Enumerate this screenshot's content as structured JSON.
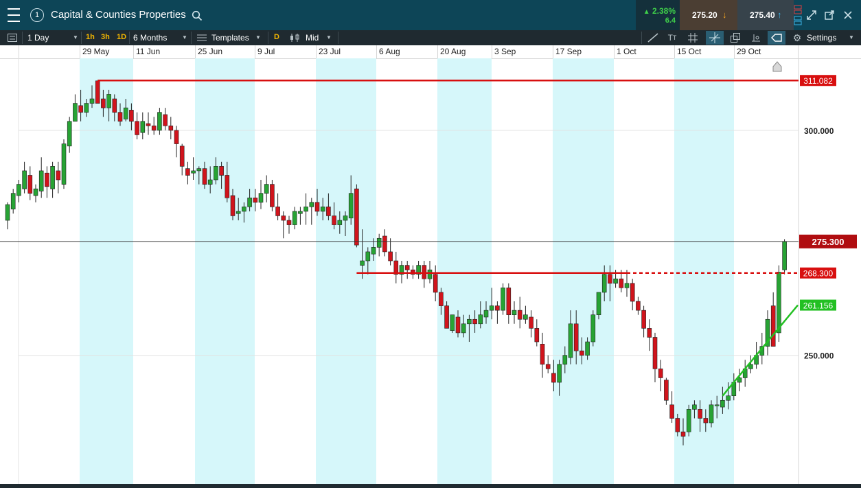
{
  "header": {
    "title": "Capital & Counties Properties",
    "tab_number": "1",
    "change_percent": "2.38%",
    "change_abs": "6.4",
    "sell_price": "275.20",
    "buy_price": "275.40"
  },
  "toolbar": {
    "interval": "1 Day",
    "quick_1": "1h",
    "quick_2": "3h",
    "quick_3": "1D",
    "range": "6 Months",
    "templates": "Templates",
    "d_label": "D",
    "price_type": "Mid",
    "settings": "Settings"
  },
  "colors": {
    "up": "#27a334",
    "down": "#d0141c",
    "resistance": "#d80f0f",
    "support": "#23c023",
    "band": "#d6f7fa",
    "header": "#0d4557",
    "toolbar": "#1f2a30"
  },
  "icons": [
    "menu-icon",
    "search-icon",
    "draw-line-icon",
    "text-icon",
    "grid-icon",
    "crosshair-icon",
    "layers-icon",
    "indicator-icon",
    "tag-icon",
    "gear-icon",
    "expand-icon",
    "popout-icon",
    "close-icon"
  ],
  "chart_data": {
    "type": "candlestick",
    "x_axis_labels": [
      "29 May",
      "11 Jun",
      "25 Jun",
      "9 Jul",
      "23 Jul",
      "6 Aug",
      "20 Aug",
      "3 Sep",
      "17 Sep",
      "1 Oct",
      "15 Oct",
      "29 Oct"
    ],
    "y_ticks": [
      250,
      300
    ],
    "y_tick_labels": [
      "250.000",
      "300.000"
    ],
    "ylim": [
      226,
      316
    ],
    "current_price": 275.3,
    "current_price_label": "275.300",
    "levels": [
      {
        "value": 311.082,
        "label": "311.082",
        "start_index": 16,
        "style": "solid",
        "color": "#d80f0f"
      },
      {
        "value": 268.3,
        "label": "268.300",
        "start_index": 62,
        "style": "solid-then-dashed",
        "dash_from_index": 110,
        "color": "#d80f0f"
      }
    ],
    "trendline": {
      "from_index": 127,
      "from_value": 241,
      "to_index": 146,
      "to_value": 261.156,
      "label": "261.156",
      "color": "#23c023"
    },
    "candles": [
      [
        280,
        284,
        278,
        283.5
      ],
      [
        282.5,
        287,
        281.5,
        286
      ],
      [
        285.5,
        289,
        284,
        288
      ],
      [
        287,
        293,
        286,
        291
      ],
      [
        290,
        292,
        284.5,
        286
      ],
      [
        285.5,
        288,
        284,
        287
      ],
      [
        286.5,
        294,
        285,
        291
      ],
      [
        290.5,
        292,
        285,
        287.5
      ],
      [
        287,
        293,
        285,
        292
      ],
      [
        291,
        293,
        286,
        289
      ],
      [
        288,
        298,
        287,
        297
      ],
      [
        296.5,
        303,
        295,
        302
      ],
      [
        302,
        308,
        302,
        306
      ],
      [
        305.5,
        309,
        302,
        304
      ],
      [
        304,
        307,
        303,
        306
      ],
      [
        306,
        310,
        305,
        307
      ],
      [
        311,
        311,
        307,
        306
      ],
      [
        307,
        309,
        303,
        305
      ],
      [
        305,
        309,
        302,
        308
      ],
      [
        307,
        308,
        302,
        304
      ],
      [
        304,
        306,
        301,
        302
      ],
      [
        302.5,
        307,
        302,
        305
      ],
      [
        304.5,
        306,
        300,
        302
      ],
      [
        302,
        304,
        298,
        299
      ],
      [
        299.5,
        304,
        298,
        302
      ],
      [
        301.5,
        304,
        299,
        301
      ],
      [
        301,
        303,
        299,
        300
      ],
      [
        300,
        305,
        299,
        304
      ],
      [
        303.5,
        305,
        300,
        301
      ],
      [
        301,
        303,
        298,
        300
      ],
      [
        300,
        301,
        294,
        297
      ],
      [
        296.5,
        297,
        290,
        292
      ],
      [
        291.5,
        293,
        288,
        290
      ],
      [
        290.5,
        294,
        289,
        291
      ],
      [
        291,
        292,
        288,
        291.5
      ],
      [
        291.5,
        293,
        287,
        288
      ],
      [
        288,
        292,
        286,
        289
      ],
      [
        289,
        294,
        288,
        292
      ],
      [
        292,
        293,
        287,
        290
      ],
      [
        290,
        293,
        284,
        285
      ],
      [
        285.5,
        287,
        280,
        281
      ],
      [
        281.5,
        285,
        280,
        282
      ],
      [
        282,
        284,
        279.5,
        283
      ],
      [
        283,
        287,
        282,
        285
      ],
      [
        285,
        287,
        282,
        284
      ],
      [
        284,
        289,
        282.5,
        286
      ],
      [
        286,
        290,
        284,
        288
      ],
      [
        288,
        289,
        282,
        283
      ],
      [
        283,
        286,
        280,
        281
      ],
      [
        281,
        282,
        276,
        280
      ],
      [
        280,
        281,
        277,
        279
      ],
      [
        279,
        283,
        278,
        282
      ],
      [
        281.5,
        283,
        279,
        282
      ],
      [
        282,
        286,
        279,
        283
      ],
      [
        283,
        285,
        279,
        284
      ],
      [
        284,
        287,
        281,
        282
      ],
      [
        282,
        285,
        280,
        283
      ],
      [
        283,
        286,
        280,
        281
      ],
      [
        281,
        284,
        278,
        279
      ],
      [
        279,
        282,
        277,
        280
      ],
      [
        280,
        282,
        276.5,
        281
      ],
      [
        280.5,
        290,
        279,
        286
      ],
      [
        287,
        288,
        274,
        274.5
      ],
      [
        270,
        278,
        267,
        271
      ],
      [
        271,
        274,
        268,
        273
      ],
      [
        272.5,
        276,
        271,
        274
      ],
      [
        274,
        277,
        272,
        276
      ],
      [
        276.5,
        278,
        272,
        273
      ],
      [
        273,
        276,
        270,
        271
      ],
      [
        271,
        273,
        266,
        268
      ],
      [
        268,
        271,
        266,
        270
      ],
      [
        270,
        271,
        267,
        269
      ],
      [
        269,
        270,
        267,
        268
      ],
      [
        268,
        271,
        267,
        270
      ],
      [
        270,
        271,
        265,
        267
      ],
      [
        267,
        271,
        266,
        269
      ],
      [
        268,
        270,
        262,
        264
      ],
      [
        264,
        265,
        259,
        261
      ],
      [
        261,
        262,
        256,
        256
      ],
      [
        255.5,
        259,
        255,
        259
      ],
      [
        258.5,
        260,
        254,
        255
      ],
      [
        255,
        259,
        254,
        257
      ],
      [
        257,
        259,
        253,
        258
      ],
      [
        258,
        260,
        255,
        257
      ],
      [
        257,
        262,
        256,
        259
      ],
      [
        258.5,
        262,
        257,
        260
      ],
      [
        260,
        265,
        258,
        261
      ],
      [
        261,
        262,
        257,
        260
      ],
      [
        260,
        266,
        259,
        265
      ],
      [
        265,
        266,
        257,
        259
      ],
      [
        259,
        262,
        257,
        260
      ],
      [
        260,
        263,
        256,
        258
      ],
      [
        258,
        261,
        257,
        259
      ],
      [
        258.5,
        260,
        254,
        256
      ],
      [
        256,
        258,
        252,
        253
      ],
      [
        252.5,
        255,
        245,
        248
      ],
      [
        248,
        250,
        246,
        247
      ],
      [
        246,
        249,
        242,
        244
      ],
      [
        244,
        249,
        241,
        248
      ],
      [
        248,
        252,
        246,
        250
      ],
      [
        249.5,
        260,
        248,
        257
      ],
      [
        257,
        260,
        248,
        251
      ],
      [
        251,
        254,
        248,
        250
      ],
      [
        250,
        254,
        249,
        253
      ],
      [
        253,
        260,
        252,
        259
      ],
      [
        259,
        263,
        258,
        264
      ],
      [
        264,
        270,
        262,
        268
      ],
      [
        268,
        270,
        262,
        266
      ],
      [
        266,
        269,
        265,
        267
      ],
      [
        267,
        269,
        264,
        265
      ],
      [
        265,
        269,
        263,
        266
      ],
      [
        266,
        267,
        260,
        262
      ],
      [
        262,
        263,
        259,
        260
      ],
      [
        260,
        261,
        254,
        256
      ],
      [
        256,
        258,
        251,
        254
      ],
      [
        254,
        255,
        244,
        247
      ],
      [
        247,
        249,
        242,
        245
      ],
      [
        244.5,
        245,
        239,
        240
      ],
      [
        239,
        242,
        235,
        236
      ],
      [
        236,
        237,
        232,
        233
      ],
      [
        233,
        236,
        230,
        232
      ],
      [
        233,
        239,
        232,
        238
      ],
      [
        238,
        240,
        236,
        239
      ],
      [
        238,
        240,
        233,
        236
      ],
      [
        236,
        238,
        233,
        235
      ],
      [
        235,
        240,
        234,
        239
      ],
      [
        239,
        241,
        236,
        239
      ],
      [
        238.5,
        243,
        237,
        240
      ],
      [
        240,
        244,
        238,
        241
      ],
      [
        241,
        246,
        240,
        244
      ],
      [
        244,
        247,
        242,
        245
      ],
      [
        245,
        249,
        243,
        247
      ],
      [
        247,
        250,
        246,
        248
      ],
      [
        248,
        253,
        247,
        250
      ],
      [
        250,
        255,
        248,
        252
      ],
      [
        252,
        260,
        250,
        258
      ],
      [
        261,
        264,
        252,
        252
      ],
      [
        255,
        270,
        253,
        268.5
      ],
      [
        269,
        275.8,
        268,
        275.3
      ]
    ]
  }
}
